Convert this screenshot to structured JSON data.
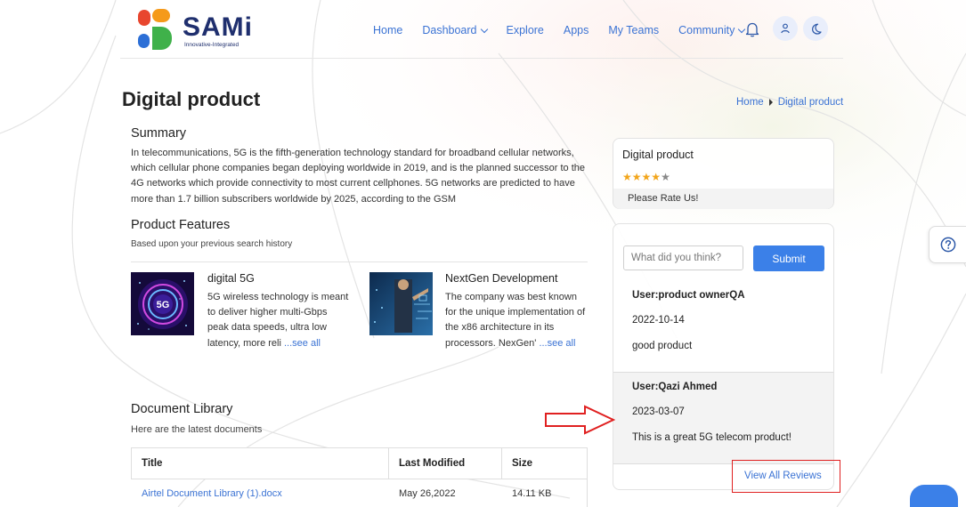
{
  "header": {
    "logo_text": "SAMi",
    "logo_tagline": "Innovative-Integrated",
    "nav": [
      {
        "label": "Home"
      },
      {
        "label": "Dashboard",
        "dropdown": true
      },
      {
        "label": "Explore"
      },
      {
        "label": "Apps"
      },
      {
        "label": "My Teams"
      },
      {
        "label": "Community",
        "dropdown": true
      }
    ],
    "icons": [
      "bell-icon",
      "user-icon",
      "moon-icon"
    ]
  },
  "page": {
    "title": "Digital product",
    "breadcrumb": [
      "Home",
      "Digital product"
    ]
  },
  "summary": {
    "heading": "Summary",
    "text": "In telecommunications, 5G is the fifth-generation technology standard for broadband cellular networks, which cellular phone companies began deploying worldwide in 2019, and is the planned successor to the 4G networks which provide connectivity to most current cellphones. 5G networks are predicted to have more than 1.7 billion subscribers worldwide by 2025, according to the GSM"
  },
  "features": {
    "heading": "Product Features",
    "subheading": "Based upon your previous search history",
    "items": [
      {
        "name": "digital 5G",
        "desc": "5G wireless technology is meant to deliver higher multi-Gbps peak data speeds, ultra low latency, more reli",
        "see_all": "...see all"
      },
      {
        "name": "NextGen Development",
        "desc": "The company was best known for the unique implementation of the x86 architecture in its processors. NexGen'",
        "see_all": "...see all"
      }
    ]
  },
  "documents": {
    "heading": "Document Library",
    "subheading": "Here are the latest documents",
    "columns": [
      "Title",
      "Last Modified",
      "Size"
    ],
    "rows": [
      {
        "title": "Airtel Document Library (1).docx",
        "modified": "May 26,2022",
        "size": "14.11 KB"
      }
    ]
  },
  "rating": {
    "title": "Digital product",
    "stars_filled": 4,
    "stars_total": 5,
    "prompt": "Please Rate Us!"
  },
  "reviews": {
    "input_placeholder": "What did you think?",
    "submit_label": "Submit",
    "items": [
      {
        "user": "User:product ownerQA",
        "date": "2022-10-14",
        "text": "good product"
      },
      {
        "user": "User:Qazi Ahmed",
        "date": "2023-03-07",
        "text": "This is a great 5G telecom product!"
      }
    ],
    "view_all_label": "View All Reviews"
  },
  "colors": {
    "link": "#3b73d4",
    "button": "#3b80e8",
    "star": "#f2a51a",
    "annotation": "#e02020"
  }
}
